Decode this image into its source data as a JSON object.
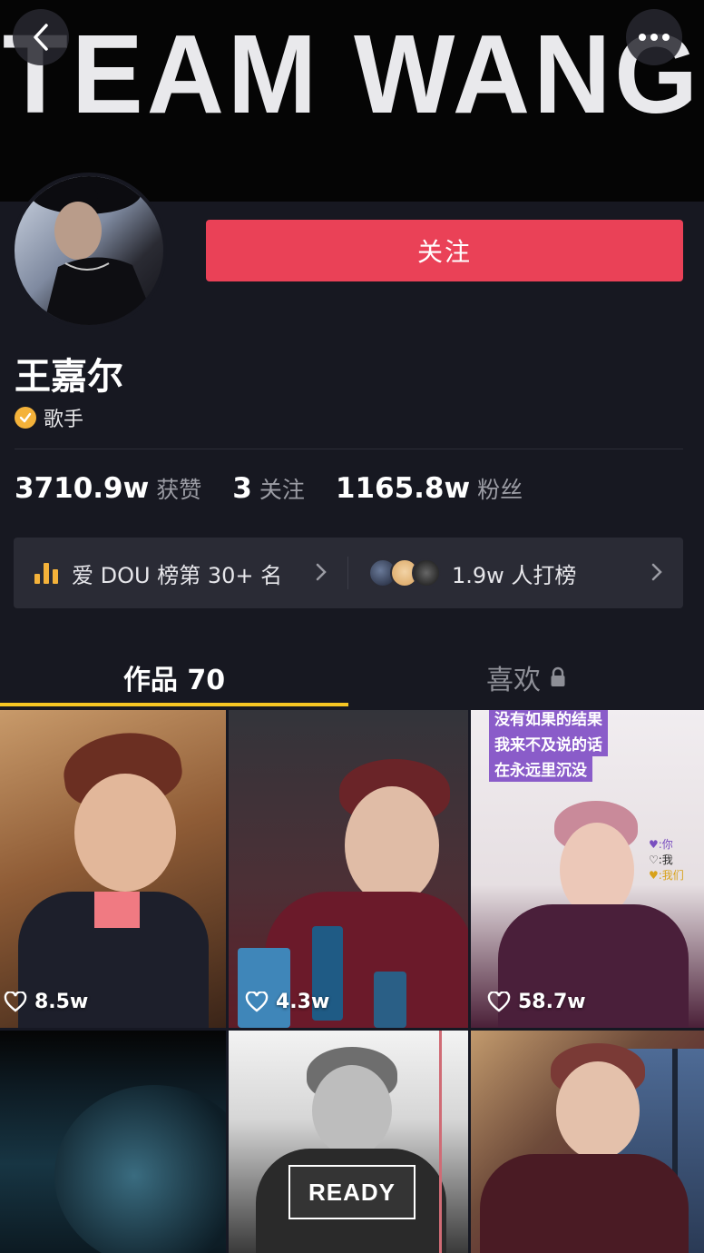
{
  "banner": {
    "text": "TEAM WANG"
  },
  "profile": {
    "follow_label": "关注",
    "name": "王嘉尔",
    "verify_label": "歌手"
  },
  "stats": [
    {
      "value": "3710.9w",
      "label": "获赞"
    },
    {
      "value": "3",
      "label": "关注"
    },
    {
      "value": "1165.8w",
      "label": "粉丝"
    }
  ],
  "rank": {
    "left_label": "爱 DOU 榜第 30+ 名",
    "right_label": "1.9w 人打榜"
  },
  "tabs": {
    "works": "作品 70",
    "likes": "喜欢"
  },
  "videos": [
    {
      "likes": "8.5w"
    },
    {
      "likes": "4.3w"
    },
    {
      "likes": "58.7w",
      "captions": [
        "没有如果的结果",
        "我来不及说的话",
        "在永远里沉没"
      ],
      "legend": [
        "♥:你",
        "♡:我",
        "♥:我们"
      ]
    },
    {},
    {
      "overlay": "READY"
    },
    {}
  ],
  "colors": {
    "follow": "#ea4157",
    "tab_underline": "#f6c623",
    "background": "#161823",
    "verify": "#f4b23a"
  }
}
